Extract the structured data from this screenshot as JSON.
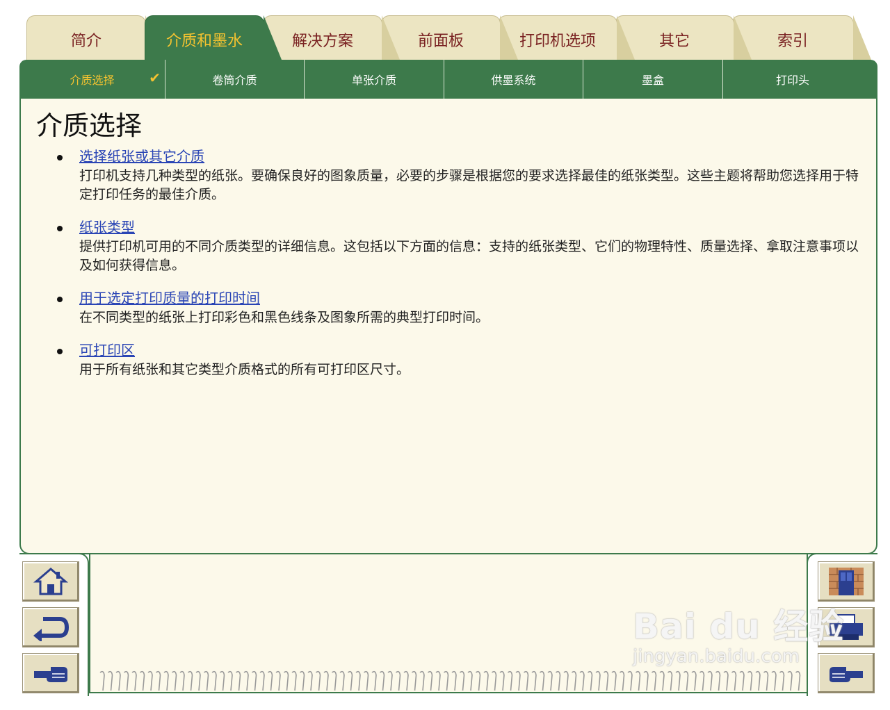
{
  "tabs": [
    {
      "label": "简介"
    },
    {
      "label": "介质和墨水"
    },
    {
      "label": "解决方案"
    },
    {
      "label": "前面板"
    },
    {
      "label": "打印机选项"
    },
    {
      "label": "其它"
    },
    {
      "label": "索引"
    }
  ],
  "active_tab": "介质和墨水",
  "subtabs": [
    {
      "label": "介质选择"
    },
    {
      "label": "卷筒介质"
    },
    {
      "label": "单张介质"
    },
    {
      "label": "供墨系统"
    },
    {
      "label": "墨盒"
    },
    {
      "label": "打印头"
    }
  ],
  "active_subtab": "介质选择",
  "page": {
    "title": "介质选择",
    "topics": [
      {
        "link": "选择纸张或其它介质",
        "desc": "打印机支持几种类型的纸张。要确保良好的图象质量，必要的步骤是根据您的要求选择最佳的纸张类型。这些主题将帮助您选择用于特定打印任务的最佳介质。"
      },
      {
        "link": "纸张类型",
        "desc": "提供打印机可用的不同介质类型的详细信息。这包括以下方面的信息：支持的纸张类型、它们的物理特性、质量选择、拿取注意事项以及如何获得信息。"
      },
      {
        "link": "用于选定打印质量的打印时间",
        "desc": "在不同类型的纸张上打印彩色和黑色线条及图象所需的典型打印时间。"
      },
      {
        "link": "可打印区",
        "desc": "用于所有纸张和其它类型介质格式的所有可打印区尺寸。"
      }
    ]
  },
  "nav": {
    "left": [
      "home-icon",
      "back-arrow-icon",
      "previous-hand-icon"
    ],
    "right": [
      "door-icon",
      "printer-icon",
      "next-hand-icon"
    ]
  },
  "watermark": {
    "logo": "Bai du 经验",
    "url": "jingyan.baidu.com"
  },
  "colors": {
    "green": "#3d7a4b",
    "gold": "#f5c330",
    "tab": "#ece5c2",
    "panel": "#fcf9ea",
    "tab_text": "#7a2222",
    "link": "#2a45b5"
  }
}
